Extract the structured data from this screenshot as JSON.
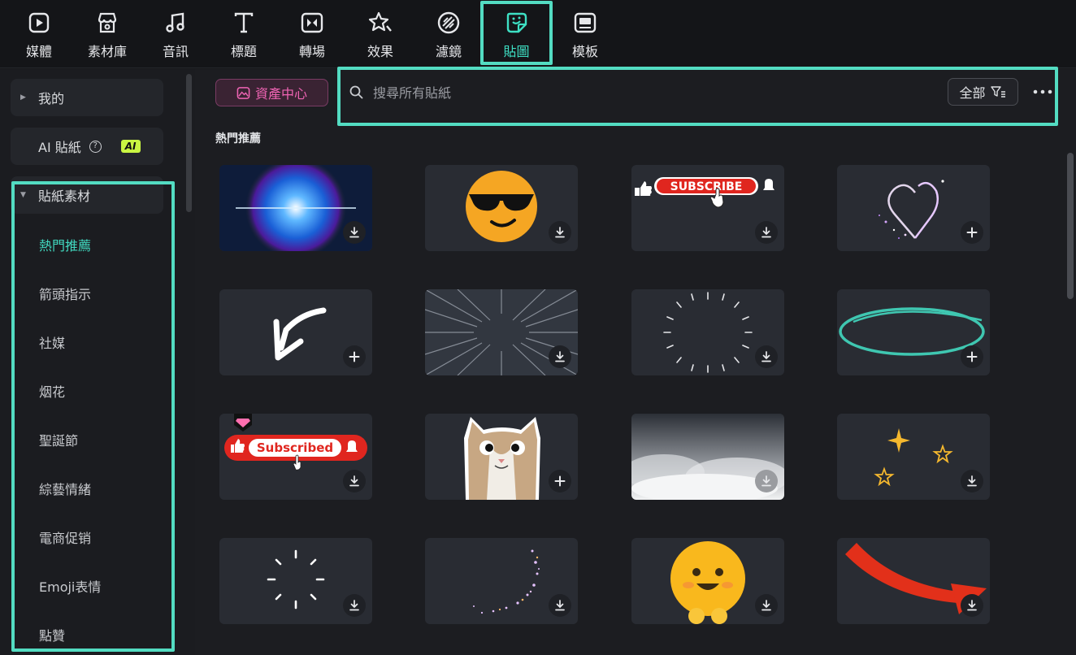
{
  "toolbar": {
    "tabs": [
      {
        "label": "媒體",
        "icon": "media-icon"
      },
      {
        "label": "素材庫",
        "icon": "store-icon"
      },
      {
        "label": "音訊",
        "icon": "music-note-icon"
      },
      {
        "label": "標題",
        "icon": "text-t-icon"
      },
      {
        "label": "轉場",
        "icon": "transition-icon"
      },
      {
        "label": "效果",
        "icon": "effects-star-icon"
      },
      {
        "label": "濾鏡",
        "icon": "filter-icon"
      },
      {
        "label": "貼圖",
        "icon": "sticker-icon",
        "active": true
      },
      {
        "label": "模板",
        "icon": "template-icon"
      }
    ]
  },
  "sidebar": {
    "my": "我的",
    "ai_sticker": "AI 貼紙",
    "ai_badge": "AI",
    "ai_help": "?",
    "materials": "貼紙素材",
    "items": [
      "熱門推薦",
      "箭頭指示",
      "社媒",
      "烟花",
      "聖誕節",
      "綜藝情緒",
      "電商促销",
      "Emoji表情",
      "點贊"
    ]
  },
  "main": {
    "asset_center": "資產中心",
    "search_placeholder": "搜尋所有貼紙",
    "filter_label": "全部",
    "section_title": "熱門推薦",
    "sticker_texts": {
      "subscribe": "SUBSCRIBE",
      "subscribed": "Subscribed"
    }
  },
  "colors": {
    "accent": "#53dcc2",
    "active_text": "#41d9c0",
    "asset_pink": "#f064b4",
    "ai_badge": "#c9f542"
  }
}
